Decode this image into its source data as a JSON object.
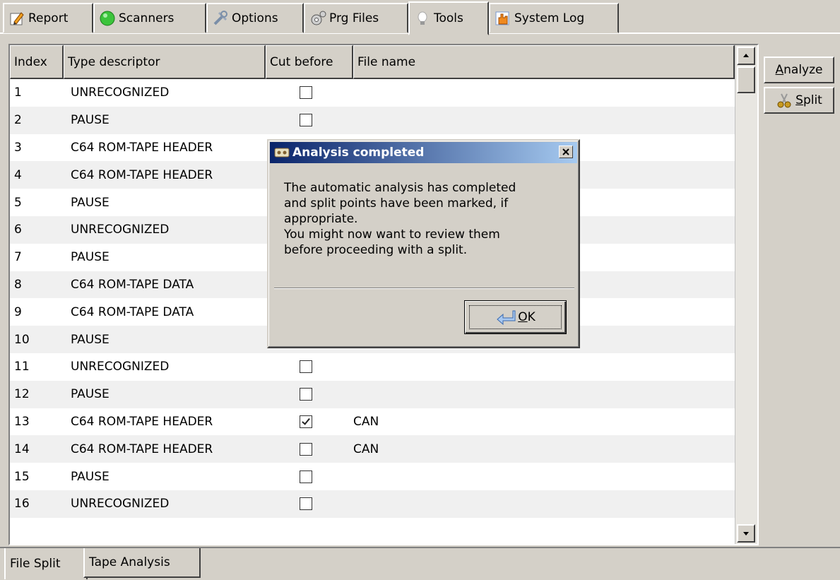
{
  "top_tabs": [
    {
      "label": "Report",
      "icon": "pencil-icon"
    },
    {
      "label": "Scanners",
      "icon": "green-circle-icon"
    },
    {
      "label": "Options",
      "icon": "tools-icon"
    },
    {
      "label": "Prg Files",
      "icon": "gears-icon"
    },
    {
      "label": "Tools",
      "icon": "lightbulb-icon"
    },
    {
      "label": "System Log",
      "icon": "hand-icon"
    }
  ],
  "active_top_tab": "Tools",
  "table": {
    "headers": [
      "Index",
      "Type descriptor",
      "Cut before",
      "File name"
    ],
    "rows": [
      {
        "index": "1",
        "type": "UNRECOGNIZED",
        "cut": false,
        "file": ""
      },
      {
        "index": "2",
        "type": "PAUSE",
        "cut": false,
        "file": ""
      },
      {
        "index": "3",
        "type": "C64 ROM-TAPE HEADER",
        "cut": false,
        "file": ""
      },
      {
        "index": "4",
        "type": "C64 ROM-TAPE HEADER",
        "cut": false,
        "file": ""
      },
      {
        "index": "5",
        "type": "PAUSE",
        "cut": false,
        "file": ""
      },
      {
        "index": "6",
        "type": "UNRECOGNIZED",
        "cut": false,
        "file": ""
      },
      {
        "index": "7",
        "type": "PAUSE",
        "cut": false,
        "file": ""
      },
      {
        "index": "8",
        "type": "C64 ROM-TAPE DATA",
        "cut": false,
        "file": ""
      },
      {
        "index": "9",
        "type": "C64 ROM-TAPE DATA",
        "cut": false,
        "file": ""
      },
      {
        "index": "10",
        "type": "PAUSE",
        "cut": false,
        "file": ""
      },
      {
        "index": "11",
        "type": "UNRECOGNIZED",
        "cut": false,
        "file": ""
      },
      {
        "index": "12",
        "type": "PAUSE",
        "cut": false,
        "file": ""
      },
      {
        "index": "13",
        "type": "C64 ROM-TAPE HEADER",
        "cut": true,
        "file": "CAN"
      },
      {
        "index": "14",
        "type": "C64 ROM-TAPE HEADER",
        "cut": false,
        "file": "CAN"
      },
      {
        "index": "15",
        "type": "PAUSE",
        "cut": false,
        "file": ""
      },
      {
        "index": "16",
        "type": "UNRECOGNIZED",
        "cut": false,
        "file": ""
      }
    ]
  },
  "buttons": {
    "analyze": {
      "label_first": "A",
      "label_rest": "nalyze"
    },
    "split": {
      "label_first": "S",
      "label_rest": "plit",
      "icon": "scissors-icon"
    }
  },
  "bottom_tabs": [
    {
      "label": "File Split"
    },
    {
      "label": "Tape Analysis"
    }
  ],
  "dialog": {
    "title": "Analysis completed",
    "message_lines": [
      "The automatic analysis has completed",
      "and split points have been marked, if",
      "appropriate.",
      "You might now want to review them",
      "before proceeding with a split."
    ],
    "ok_first": "O",
    "ok_rest": "K"
  },
  "colors": {
    "window_bg": "#d4d0c8",
    "title_gradient_start": "#0a246a",
    "title_gradient_end": "#a6caf0"
  }
}
